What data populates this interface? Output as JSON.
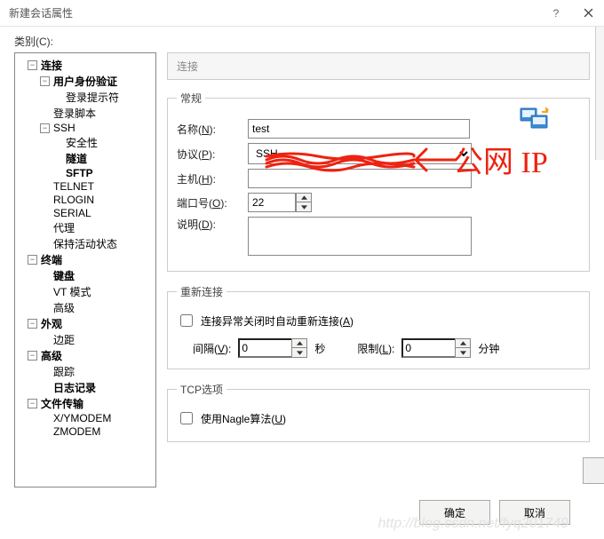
{
  "window": {
    "title": "新建会话属性",
    "help": "?",
    "close": "×"
  },
  "category_label": "类别(C):",
  "tree": {
    "connection": "连接",
    "auth": "用户身份验证",
    "login_prompt": "登录提示符",
    "login_script": "登录脚本",
    "ssh": "SSH",
    "security": "安全性",
    "tunnel": "隧道",
    "sftp": "SFTP",
    "telnet": "TELNET",
    "rlogin": "RLOGIN",
    "serial": "SERIAL",
    "proxy": "代理",
    "keepalive": "保持活动状态",
    "terminal": "终端",
    "keyboard": "键盘",
    "vtmode": "VT 模式",
    "advanced_t": "高级",
    "appearance": "外观",
    "margin": "边距",
    "advanced": "高级",
    "trace": "跟踪",
    "logging": "日志记录",
    "filetransfer": "文件传输",
    "xymodem": "X/YMODEM",
    "zmodem": "ZMODEM"
  },
  "panel_title": "连接",
  "general": {
    "legend": "常规",
    "name_label": "名称(N):",
    "name_value": "test",
    "proto_label": "协议(P):",
    "proto_value": "SSH",
    "host_label": "主机(H):",
    "host_value": "",
    "port_label": "端口号(O):",
    "port_value": "22",
    "desc_label": "说明(D):",
    "desc_value": ""
  },
  "reconnect": {
    "legend": "重新连接",
    "auto_label": "连接异常关闭时自动重新连接(A)",
    "interval_label": "间隔(V):",
    "interval_value": "0",
    "interval_unit": "秒",
    "limit_label": "限制(L):",
    "limit_value": "0",
    "limit_unit": "分钟"
  },
  "tcp": {
    "legend": "TCP选项",
    "nagle_label": "使用Nagle算法(U)"
  },
  "buttons": {
    "ok": "确定",
    "cancel": "取消"
  },
  "annotation": "公网 IP",
  "watermark": "http://blog.csdn.net/fyq201749"
}
